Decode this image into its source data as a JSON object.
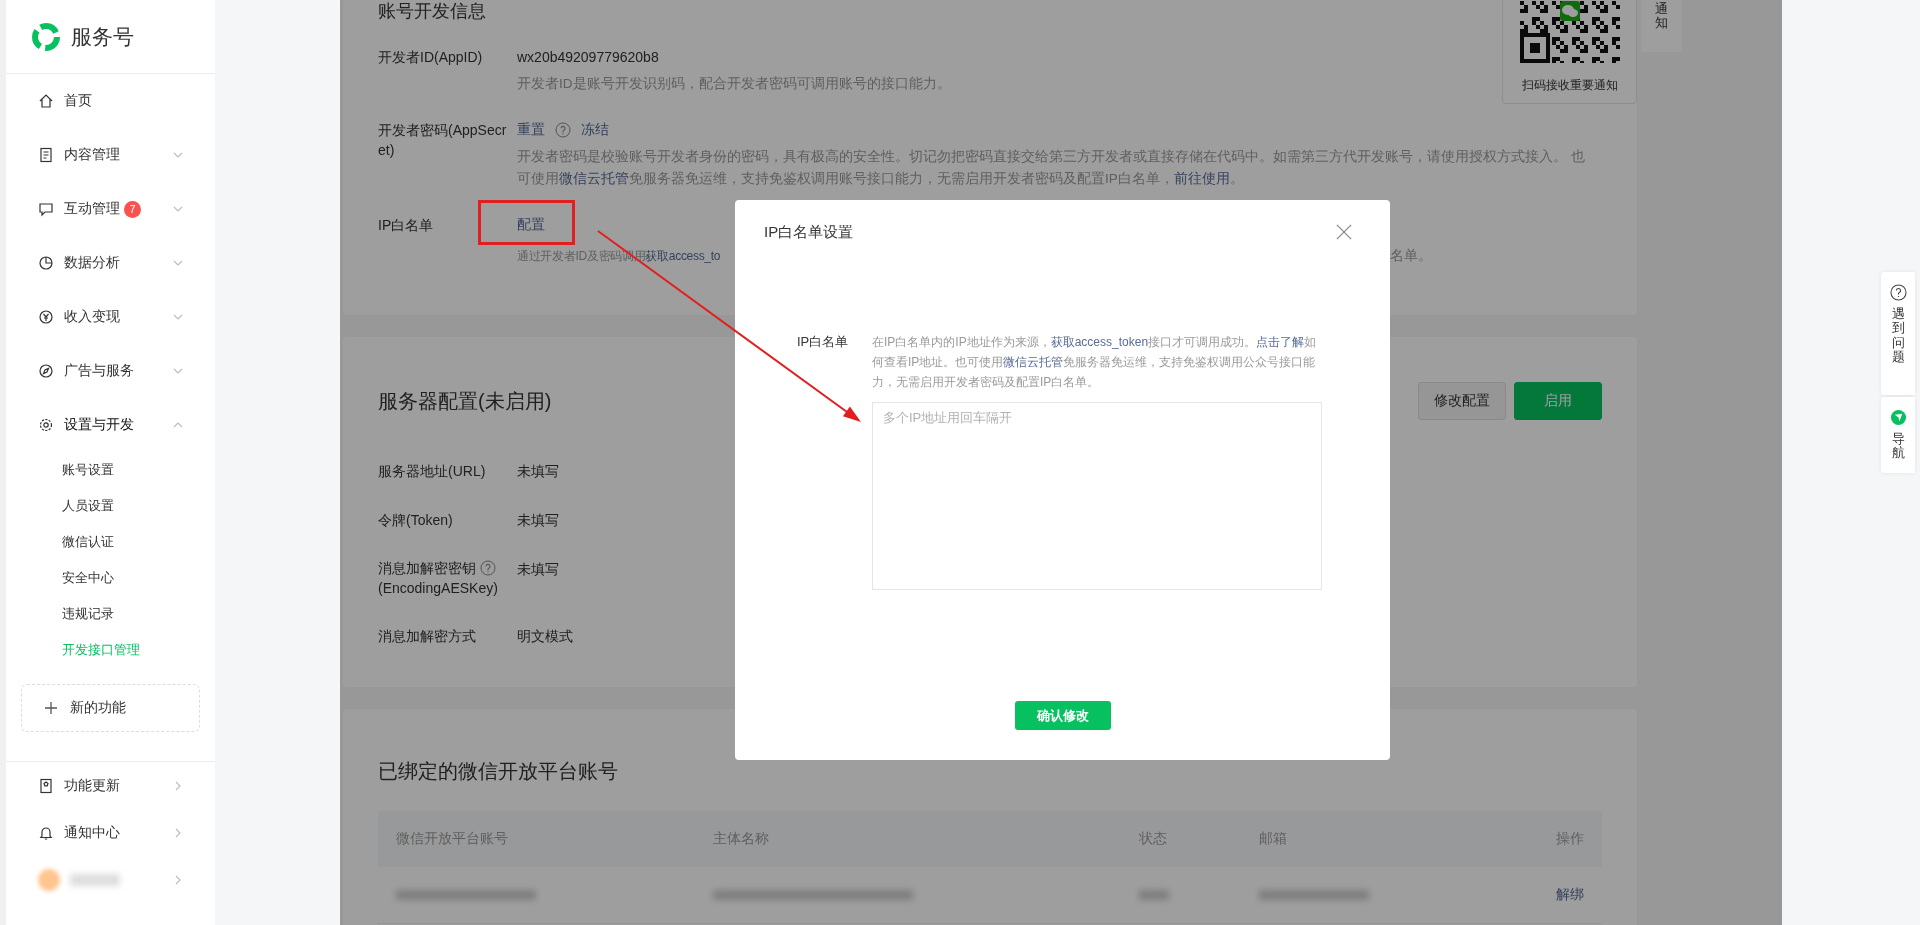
{
  "sidebar": {
    "logo_text": "服务号",
    "menu": [
      {
        "label": "首页",
        "kind": "link"
      },
      {
        "label": "内容管理",
        "kind": "group",
        "expanded": false
      },
      {
        "label": "互动管理",
        "kind": "group",
        "badge": "7",
        "expanded": false
      },
      {
        "label": "数据分析",
        "kind": "group",
        "expanded": false
      },
      {
        "label": "收入变现",
        "kind": "group",
        "expanded": false
      },
      {
        "label": "广告与服务",
        "kind": "group",
        "expanded": false
      },
      {
        "label": "设置与开发",
        "kind": "group",
        "expanded": true,
        "children": [
          {
            "label": "账号设置",
            "selected": false
          },
          {
            "label": "人员设置",
            "selected": false
          },
          {
            "label": "微信认证",
            "selected": false
          },
          {
            "label": "安全中心",
            "selected": false
          },
          {
            "label": "违规记录",
            "selected": false
          },
          {
            "label": "开发接口管理",
            "selected": true
          }
        ]
      }
    ],
    "new_feature": "新的功能",
    "bottom": [
      {
        "label": "功能更新"
      },
      {
        "label": "通知中心"
      }
    ]
  },
  "dev_info": {
    "title": "账号开发信息",
    "rows": [
      {
        "label": "开发者ID(AppID)",
        "value": "wx20b49209779620b8",
        "actions": [],
        "description": [
          {
            "kind": "text",
            "text": "开发者ID是账号开发识别码，配合开发者密码可调用账号的接口能力。"
          }
        ],
        "description_end": []
      },
      {
        "label": "开发者密码(AppSecret)",
        "actions": [
          {
            "kind": "link",
            "label": "重置"
          },
          {
            "kind": "help"
          },
          {
            "kind": "link",
            "label": "冻结"
          }
        ],
        "description": [
          {
            "kind": "text",
            "text": "开发者密码是校验账号开发者身份的密码，具有极高的安全性。切记勿把密码直接交给第三方开发者或直接存储在代码中。如需第三方代开发账号，请使用授权方式接入。 也可使用"
          },
          {
            "kind": "link",
            "text": "微信云托管"
          },
          {
            "kind": "text",
            "text": "免服务器免运维，支持免鉴权调用账号接口能力，无需启用开发者密码及配置IP白名单，"
          },
          {
            "kind": "link",
            "text": "前往使用"
          },
          {
            "kind": "text",
            "text": "。"
          }
        ],
        "description_end": []
      },
      {
        "label": "IP白名单",
        "actions": [
          {
            "kind": "link",
            "label": "配置"
          }
        ],
        "description": [
          {
            "kind": "text",
            "text": "通过开发者ID及密码调用"
          },
          {
            "kind": "link",
            "text": "获取access_to"
          }
        ],
        "description_end": [
          {
            "kind": "text",
            "text": "名单。"
          }
        ]
      }
    ]
  },
  "qr_card": {
    "caption": "扫码接收重要通知"
  },
  "notice_tab": {
    "label": "通知"
  },
  "server": {
    "title": "服务器配置(未启用)",
    "buttons": [
      {
        "label": "修改配置",
        "kind": "default"
      },
      {
        "label": "启用",
        "kind": "primary"
      }
    ],
    "rows": [
      {
        "label": "服务器地址(URL)",
        "value": "未填写",
        "kind": "plain"
      },
      {
        "label": "令牌(Token)",
        "value": "未填写",
        "kind": "plain"
      },
      {
        "label": "消息加解密密钥",
        "label_sub": "(EncodingAESKey)",
        "value": "未填写",
        "kind": "with_help"
      },
      {
        "label": "消息加解密方式",
        "value": "明文模式",
        "kind": "plain"
      }
    ]
  },
  "bound": {
    "title": "已绑定的微信开放平台账号",
    "columns": [
      "微信开放平台账号",
      "主体名称",
      "状态",
      "邮箱",
      "操作"
    ],
    "rows": [
      {
        "action": "解绑"
      }
    ]
  },
  "float_buttons": [
    {
      "label": "遇到问题"
    },
    {
      "label": "导航"
    }
  ],
  "modal": {
    "title": "IP白名单设置",
    "field_label": "IP白名单",
    "description": [
      {
        "kind": "text",
        "text": "在IP白名单内的IP地址作为来源，"
      },
      {
        "kind": "link",
        "text": "获取access_token"
      },
      {
        "kind": "text",
        "text": "接口才可调用成功。"
      },
      {
        "kind": "link",
        "text": "点击了解"
      },
      {
        "kind": "text",
        "text": "如何查看IP地址。也可使用"
      },
      {
        "kind": "link",
        "text": "微信云托管"
      },
      {
        "kind": "text",
        "text": "免服务器免运维，支持免鉴权调用公众号接口能力，无需启用开发者密码及配置IP白名单。"
      }
    ],
    "placeholder": "多个IP地址用回车隔开",
    "confirm": "确认修改"
  }
}
